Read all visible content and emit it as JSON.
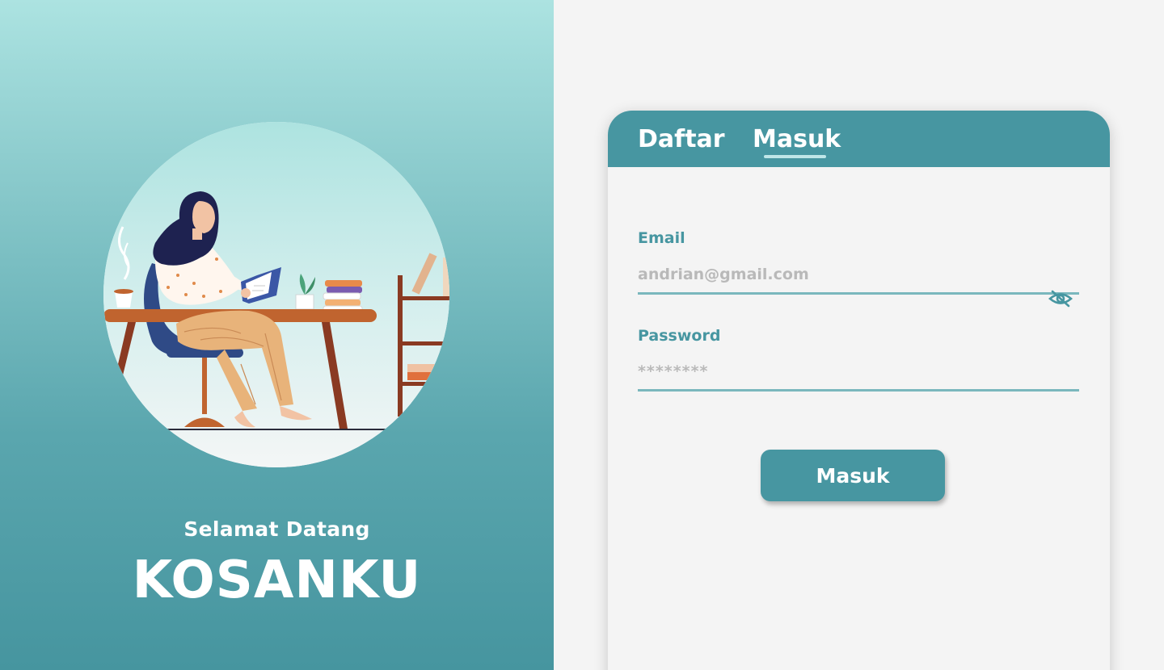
{
  "hero": {
    "welcome_text": "Selamat Datang",
    "brand_name": "KOSANKU",
    "illustration": "woman-reading-at-desk-illustration"
  },
  "auth_card": {
    "tabs": [
      {
        "label": "Daftar",
        "active": false
      },
      {
        "label": "Masuk",
        "active": true
      }
    ],
    "email": {
      "label": "Email",
      "placeholder": "andrian@gmail.com",
      "value": ""
    },
    "password": {
      "label": "Password",
      "placeholder": "********",
      "value": "",
      "toggle_icon": "eye-off-icon"
    },
    "submit_label": "Masuk"
  },
  "colors": {
    "primary": "#4796a1",
    "hero_top": "#ace3e1",
    "hero_bottom": "#46959f",
    "background": "#f4f4f4",
    "input_underline": "#7ab7bd",
    "placeholder": "#b9b9b9"
  }
}
